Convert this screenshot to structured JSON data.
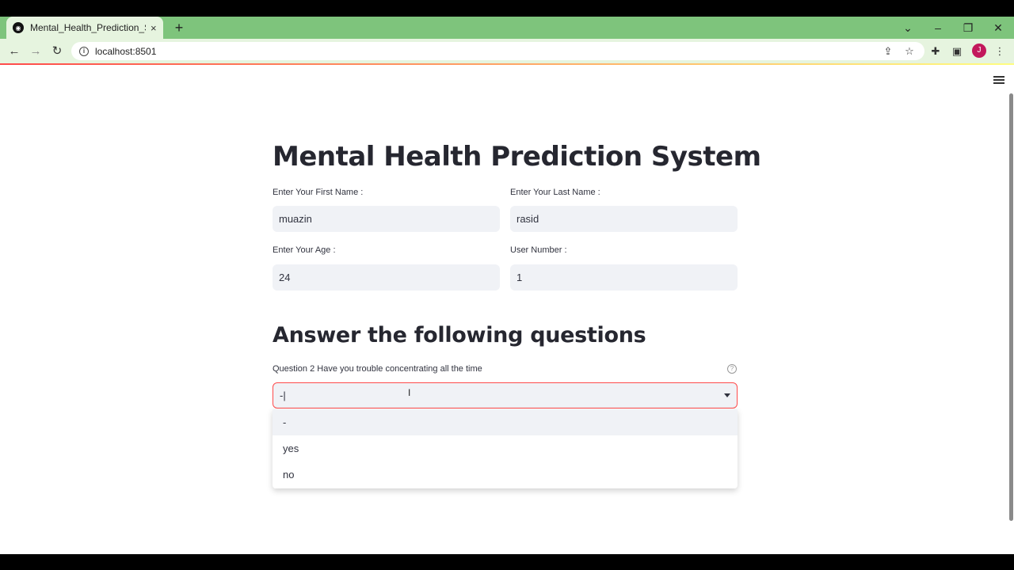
{
  "browser": {
    "tab_title": "Mental_Health_Prediction_System",
    "tab_close": "×",
    "new_tab": "+",
    "url": "localhost:8501",
    "avatar_letter": "J",
    "accent_color": "#7ec47c"
  },
  "app": {
    "title": "Mental Health Prediction System",
    "first_name_label": "Enter Your First Name :",
    "first_name_value": "muazin",
    "last_name_label": "Enter Your Last Name :",
    "last_name_value": "rasid",
    "age_label": "Enter Your Age :",
    "age_value": "24",
    "user_number_label": "User Number :",
    "user_number_value": "1",
    "section_title": "Answer the following questions",
    "question_label": "Question 2 Have you trouble concentrating all the time",
    "question_help": "?",
    "select_value": "-|",
    "options": [
      "-",
      "yes",
      "no"
    ]
  }
}
